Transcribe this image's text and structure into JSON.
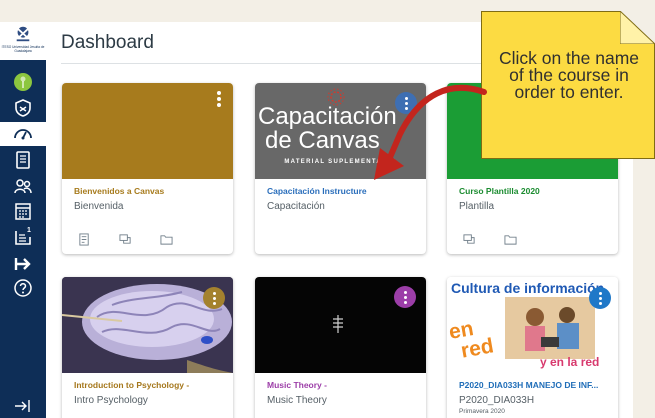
{
  "sidebar": {
    "logo_text": "ITESO Universidad Jesuita de Guadalajara",
    "inbox_badge": "1"
  },
  "header": {
    "title": "Dashboard"
  },
  "callout": {
    "text": "Click on the name of the course in order to enter."
  },
  "cards": [
    {
      "name": "Bienvenidos a Canvas",
      "code": "Bienvenida",
      "term": "",
      "color": "#a77b1d",
      "name_color": "#a77b1d"
    },
    {
      "name": "Capacitación Instructure",
      "code": "Capacitación",
      "term": "",
      "color": "#3e6fb3",
      "name_color": "#2a6ebb",
      "image_line1": "Capacitación",
      "image_line2": "de Canvas",
      "image_caption": "MATERIAL SUPLEMENTARIO"
    },
    {
      "name": "Curso Plantilla 2020",
      "code": "Plantilla",
      "term": "",
      "color": "#1b9d35",
      "name_color": "#1b8c30"
    },
    {
      "name": "Introduction to Psychology -",
      "code": "Intro Psychology",
      "term": "",
      "color": "#a4822e",
      "name_color": "#a5771c"
    },
    {
      "name": "Music Theory -",
      "code": "Music Theory",
      "term": "",
      "color": "#9c3ea8",
      "name_color": "#9c3ea8"
    },
    {
      "name": "P2020_DIA033H MANEJO DE INF...",
      "code": "P2020_DIA033H",
      "term": "Primavera 2020",
      "color": "#1f78c8",
      "name_color": "#1f6db8",
      "image_title": "Cultura de información",
      "image_en": "en",
      "image_red": "red",
      "image_tag": "y en la red"
    }
  ]
}
